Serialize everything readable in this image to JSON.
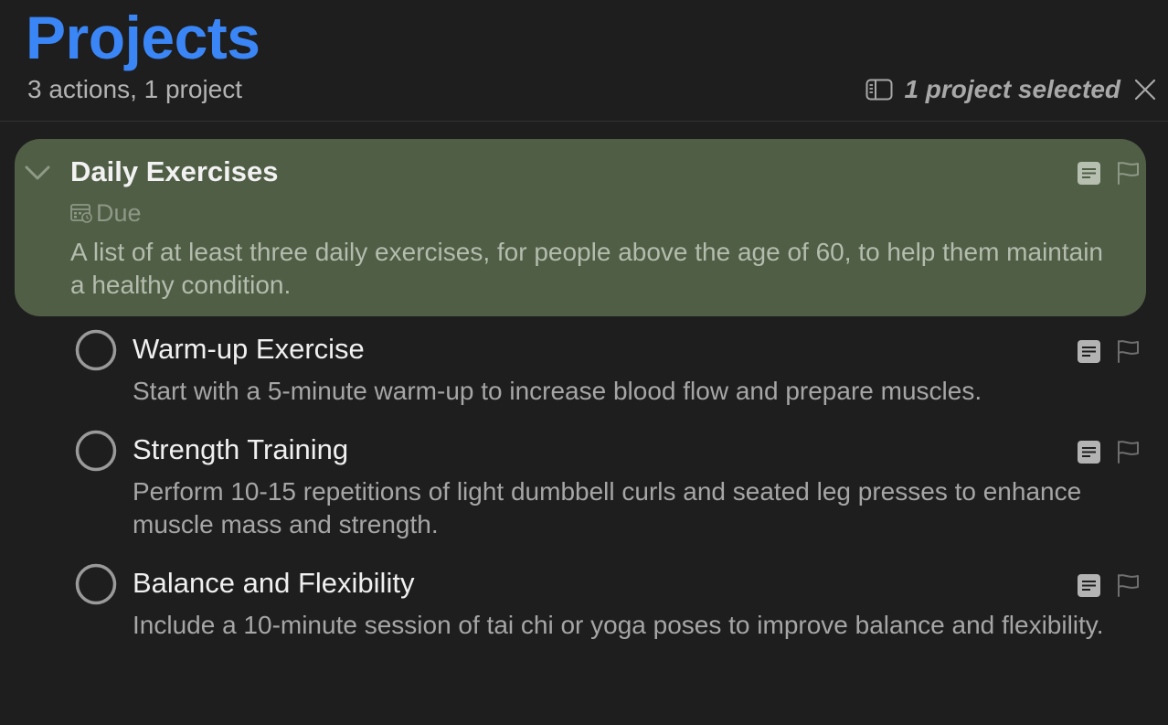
{
  "header": {
    "title": "Projects",
    "subtitle": "3 actions, 1 project",
    "selection_text": "1 project selected",
    "sidebar_icon": "sidebar-icon",
    "close_icon": "close-icon"
  },
  "project": {
    "title": "Daily Exercises",
    "due_label": "Due",
    "note": "A list of at least three daily exercises, for people above the age of 60, to help them maintain a healthy condition.",
    "expanded": true,
    "selected": true,
    "highlight_color": "#505e46"
  },
  "tasks": [
    {
      "title": "Warm-up Exercise",
      "note": "Start with a 5-minute warm-up to increase blood flow and prepare muscles."
    },
    {
      "title": "Strength Training",
      "note": "Perform 10-15 repetitions of light dumbbell curls and seated leg presses to enhance muscle mass and strength."
    },
    {
      "title": "Balance and Flexibility",
      "note": "Include a 10-minute session of tai chi or yoga poses to improve balance and flexibility."
    }
  ],
  "colors": {
    "accent": "#3b86f7",
    "background": "#1e1e1e"
  }
}
